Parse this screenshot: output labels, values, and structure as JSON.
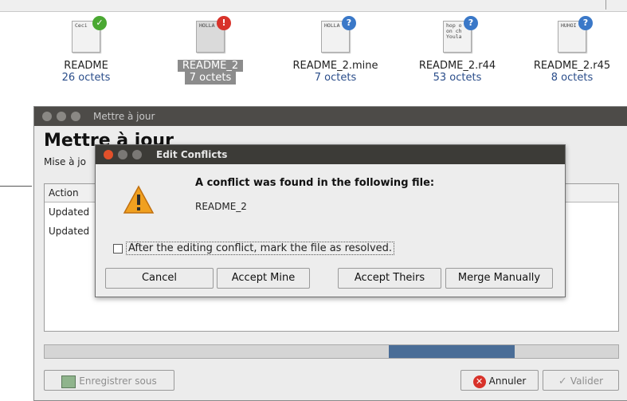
{
  "files": [
    {
      "thumb_text": "Ceci",
      "name": "README",
      "size": "26 octets",
      "badge": "ok",
      "badge_icon": "check-icon",
      "selected": false
    },
    {
      "thumb_text": "HOLLA",
      "name": "README_2",
      "size": "7 octets",
      "badge": "err",
      "badge_icon": "error-icon",
      "selected": true
    },
    {
      "thumb_text": "HOLLA",
      "name": "README_2.mine",
      "size": "7 octets",
      "badge": "q",
      "badge_icon": "question-icon",
      "selected": false
    },
    {
      "thumb_text": "hop o\non ch\nYoula",
      "name": "README_2.r44",
      "size": "53 octets",
      "badge": "q",
      "badge_icon": "question-icon",
      "selected": false
    },
    {
      "thumb_text": "HUHOI",
      "name": "README_2.r45",
      "size": "8 octets",
      "badge": "q",
      "badge_icon": "question-icon",
      "selected": false
    }
  ],
  "main_dialog": {
    "title": "Mettre à jour",
    "heading": "Mettre à jour",
    "subtitle": "Mise à jo",
    "table_header": "Action",
    "rows": [
      "Updated",
      "Updated"
    ],
    "progress": 0.22,
    "save_label": "Enregistrer sous",
    "cancel_label": "Annuler",
    "ok_label": "Valider"
  },
  "conflict_dialog": {
    "title": "Edit Conflicts",
    "message": "A conflict was found in the following file:",
    "file": "README_2",
    "checkbox_label": "After the editing conflict, mark the file as resolved.",
    "checkbox_checked": false,
    "buttons": {
      "cancel": "Cancel",
      "accept_mine": "Accept Mine",
      "accept_theirs": "Accept Theirs",
      "merge": "Merge Manually"
    }
  },
  "colors": {
    "ok": "#4aa832",
    "error": "#d8322a",
    "question": "#3a78c8",
    "progress": "#4a6d97",
    "titlebar": "#3c3b37"
  }
}
